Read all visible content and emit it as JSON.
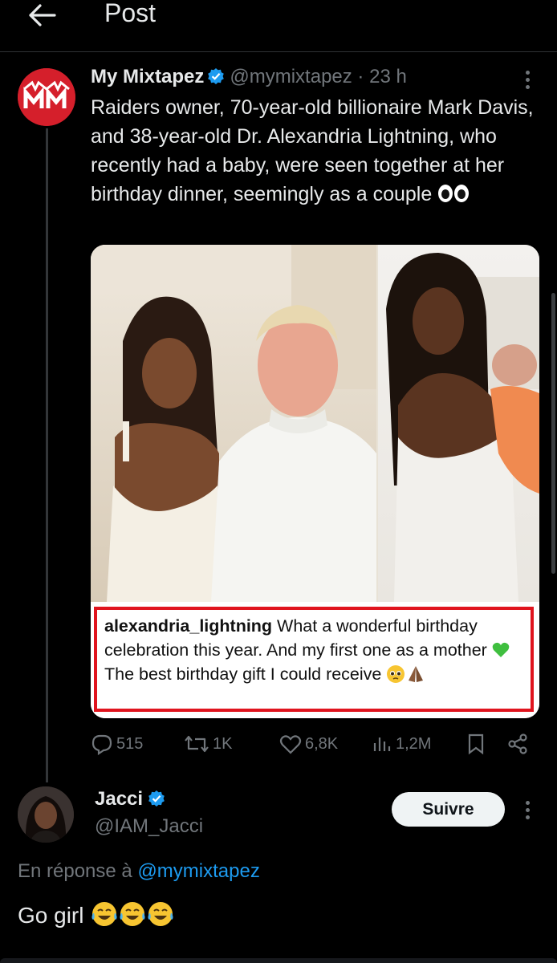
{
  "header": {
    "title": "Post"
  },
  "post": {
    "author_name": "My Mixtapez",
    "handle_time": "@mymixtapez · 23 h",
    "text": "Raiders owner, 70-year-old billionaire Mark Davis, and 38-year-old Dr. Alexandria Lightning, who recently had a baby, were seen together at her birthday dinner, seemingly as a couple",
    "text_emoji": "eyes-emoji",
    "media": {
      "caption_user": "alexandria_lightning",
      "caption_part1": " What a wonderful birthday celebration this year. And my first one as a mother ",
      "caption_part2": " The best birthday gift I could receive "
    },
    "stats": {
      "replies": "515",
      "reposts": "1K",
      "likes": "6,8K",
      "views": "1,2M"
    }
  },
  "reply": {
    "author_name": "Jacci",
    "handle": "@IAM_Jacci",
    "follow_label": "Suivre",
    "replying_prefix": "En réponse à ",
    "replying_handle": "@mymixtapez",
    "text": "Go girl "
  },
  "colors": {
    "background": "#000000",
    "verified": "#1d9bf0",
    "link": "#1d9bf0",
    "muted": "#71767b",
    "caption_border": "#e0141e",
    "brand_red": "#d51f2b"
  }
}
